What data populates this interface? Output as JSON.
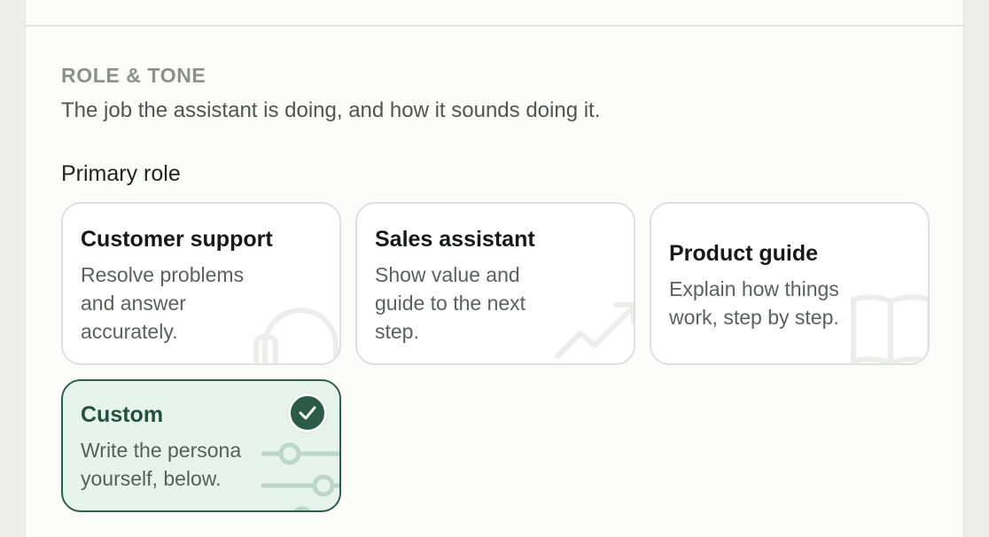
{
  "section": {
    "label": "ROLE & TONE",
    "description": "The job the assistant is doing, and how it sounds doing it."
  },
  "primary_role": {
    "label": "Primary role",
    "selected": "custom",
    "options": [
      {
        "id": "customer-support",
        "title": "Customer support",
        "desc_lines": [
          "Resolve problems",
          "and answer",
          "accurately."
        ],
        "icon": "headset-icon"
      },
      {
        "id": "sales-assistant",
        "title": "Sales assistant",
        "desc_lines": [
          "Show value and",
          "guide to the next",
          "step."
        ],
        "icon": "trend-up-icon"
      },
      {
        "id": "product-guide",
        "title": "Product guide",
        "desc_lines": [
          "Explain how things",
          "work, step by step."
        ],
        "icon": "book-icon"
      },
      {
        "id": "custom",
        "title": "Custom",
        "desc_lines": [
          "Write the persona",
          "yourself, below."
        ],
        "icon": "sliders-icon"
      }
    ]
  },
  "colors": {
    "accent": "#2b5a48",
    "selected_bg": "#e6f4ed",
    "muted_text": "#8a918c"
  }
}
